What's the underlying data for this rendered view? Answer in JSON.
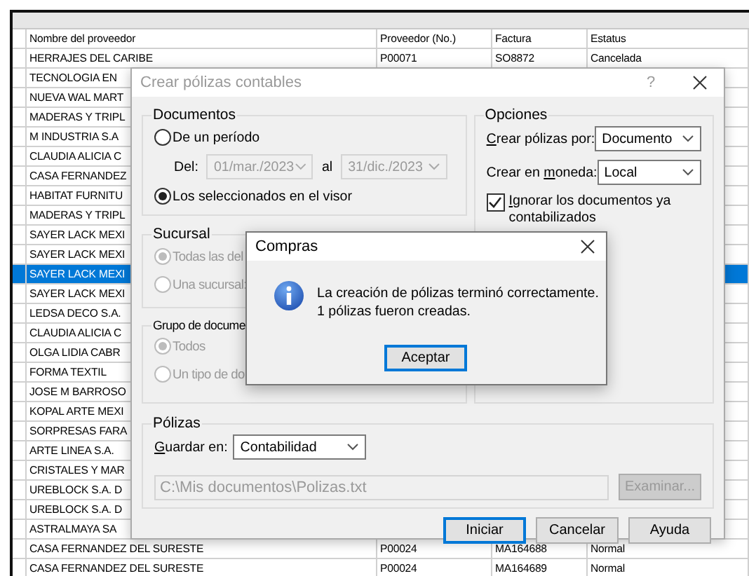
{
  "table": {
    "columns": [
      "Nombre del proveedor",
      "Proveedor (No.)",
      "Factura",
      "Estatus"
    ],
    "rows": [
      {
        "cells": [
          "HERRAJES DEL CARIBE",
          "P00071",
          "SO8872",
          "Cancelada"
        ],
        "selected": false
      },
      {
        "cells": [
          "TECNOLOGIA EN"
        ],
        "selected": false
      },
      {
        "cells": [
          "NUEVA WAL MART"
        ],
        "selected": false
      },
      {
        "cells": [
          "MADERAS Y TRIPL"
        ],
        "selected": false
      },
      {
        "cells": [
          "M INDUSTRIA S.A"
        ],
        "selected": false
      },
      {
        "cells": [
          "CLAUDIA ALICIA C"
        ],
        "selected": false
      },
      {
        "cells": [
          "CASA FERNANDEZ"
        ],
        "selected": false
      },
      {
        "cells": [
          "HABITAT FURNITU"
        ],
        "selected": false
      },
      {
        "cells": [
          "MADERAS Y TRIPL"
        ],
        "selected": false
      },
      {
        "cells": [
          "SAYER LACK MEXI"
        ],
        "selected": false
      },
      {
        "cells": [
          "SAYER LACK MEXI"
        ],
        "selected": false
      },
      {
        "cells": [
          "SAYER LACK MEXI"
        ],
        "selected": true
      },
      {
        "cells": [
          "SAYER LACK MEXI"
        ],
        "selected": false
      },
      {
        "cells": [
          "LEDSA DECO S.A."
        ],
        "selected": false
      },
      {
        "cells": [
          "CLAUDIA ALICIA C"
        ],
        "selected": false
      },
      {
        "cells": [
          "OLGA LIDIA CABR"
        ],
        "selected": false
      },
      {
        "cells": [
          "FORMA TEXTIL"
        ],
        "selected": false
      },
      {
        "cells": [
          "JOSE M BARROSO"
        ],
        "selected": false
      },
      {
        "cells": [
          "KOPAL ARTE MEXI"
        ],
        "selected": false
      },
      {
        "cells": [
          "SORPRESAS FARA"
        ],
        "selected": false
      },
      {
        "cells": [
          "ARTE LINEA S.A."
        ],
        "selected": false
      },
      {
        "cells": [
          "CRISTALES Y MAR"
        ],
        "selected": false
      },
      {
        "cells": [
          "UREBLOCK S.A. D"
        ],
        "selected": false
      },
      {
        "cells": [
          "UREBLOCK S.A. D"
        ],
        "selected": false
      },
      {
        "cells": [
          "ASTRALMAYA SA"
        ],
        "selected": false
      },
      {
        "cells": [
          "CASA FERNANDEZ DEL SURESTE",
          "P00024",
          "MA164688",
          "Normal"
        ],
        "selected": false
      },
      {
        "cells": [
          "CASA FERNANDEZ DEL SURESTE",
          "P00024",
          "MA164689",
          "Normal"
        ],
        "selected": false
      }
    ]
  },
  "dialog": {
    "title": "Crear pólizas contables",
    "help": "?",
    "documents": {
      "legend": "Documentos",
      "period": {
        "label": "De un período",
        "selected": false
      },
      "from_label": "Del:",
      "from": "01/mar./2023",
      "to_label": "al",
      "to": "31/dic./2023",
      "range_disabled": true,
      "viewer": {
        "label": "Los seleccionados en el visor",
        "selected": true
      }
    },
    "branch": {
      "legend": "Sucursal",
      "disabled": true,
      "options": [
        {
          "label": "Todas las del",
          "selected": true
        },
        {
          "label": "Una sucursal:",
          "selected": false
        }
      ]
    },
    "group": {
      "legend": "Grupo de docume",
      "disabled": true,
      "options": [
        {
          "label": "Todos",
          "selected": true
        },
        {
          "label": "Un tipo de do",
          "selected": false
        }
      ]
    },
    "options": {
      "legend": "Opciones",
      "fields": [
        {
          "label": {
            "key": "C",
            "post": "rear pólizas por:"
          },
          "value": "Documento"
        },
        {
          "label": {
            "pre": "Crear en ",
            "key": "m",
            "post": "oneda:"
          },
          "value": "Local"
        }
      ],
      "ignore": {
        "label": {
          "key": "I",
          "post": "gnorar los documentos ya contabilizados"
        },
        "checked": true
      }
    },
    "policies": {
      "legend": "Pólizas",
      "save_in": {
        "label": {
          "key": "G",
          "post": "uardar en:"
        },
        "value": "Contabilidad"
      },
      "path": "C:\\Mis documentos\\Polizas.txt",
      "path_disabled": true,
      "browse": {
        "label": "Examinar...",
        "disabled": true
      }
    },
    "buttons": [
      {
        "label": "Iniciar",
        "focused": true
      },
      {
        "label": "Cancelar",
        "focused": false
      },
      {
        "label": "Ayuda",
        "focused": false
      }
    ]
  },
  "message": {
    "title": "Compras",
    "lines": [
      "La creación de pólizas terminó correctamente.",
      "1 pólizas fueron creadas."
    ],
    "button": {
      "label": "Aceptar",
      "focused": true
    }
  }
}
